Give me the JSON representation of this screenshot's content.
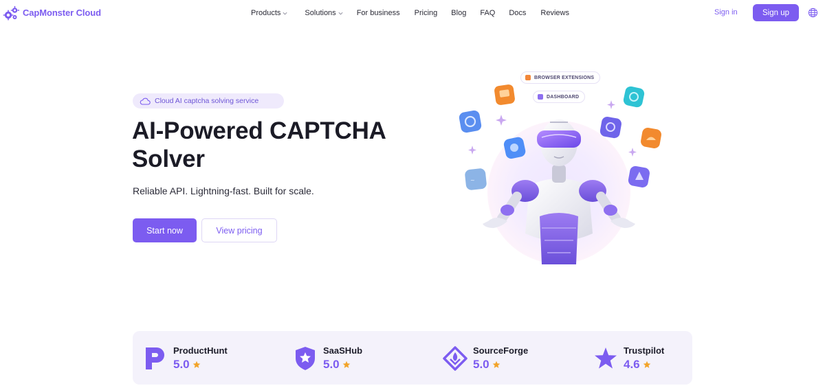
{
  "brand": {
    "name": "CapMonster Cloud",
    "accent": "#7c5cf0"
  },
  "nav": {
    "items": [
      {
        "label": "Products",
        "has_dropdown": true
      },
      {
        "label": "Solutions",
        "has_dropdown": true
      },
      {
        "label": "For business",
        "has_dropdown": false
      },
      {
        "label": "Pricing",
        "has_dropdown": false
      },
      {
        "label": "Blog",
        "has_dropdown": false
      },
      {
        "label": "FAQ",
        "has_dropdown": false
      },
      {
        "label": "Docs",
        "has_dropdown": false
      },
      {
        "label": "Reviews",
        "has_dropdown": false
      }
    ],
    "signin_label": "Sign in",
    "signup_label": "Sign up",
    "language_icon": "globe-icon"
  },
  "hero": {
    "badge": "Cloud AI captcha solving service",
    "title_line1": "AI-Powered CAPTCHA",
    "title_line2": "Solver",
    "subtitle": "Reliable API. Lightning-fast. Built for scale.",
    "primary_button": "Start now",
    "secondary_button": "View pricing"
  },
  "illustration": {
    "labels": [
      "BROWSER EXTENSIONS",
      "DASHBOARD"
    ]
  },
  "ratings": [
    {
      "name": "ProductHunt",
      "score": "5.0",
      "icon": "producthunt-icon"
    },
    {
      "name": "SaaSHub",
      "score": "5.0",
      "icon": "saashub-icon"
    },
    {
      "name": "SourceForge",
      "score": "5.0",
      "icon": "sourceforge-icon"
    },
    {
      "name": "Trustpilot",
      "score": "4.6",
      "icon": "trustpilot-icon"
    }
  ],
  "colors": {
    "star": "#f2a42a",
    "badge_bg": "#efeafc",
    "ratings_bg": "#f4f2fb"
  }
}
